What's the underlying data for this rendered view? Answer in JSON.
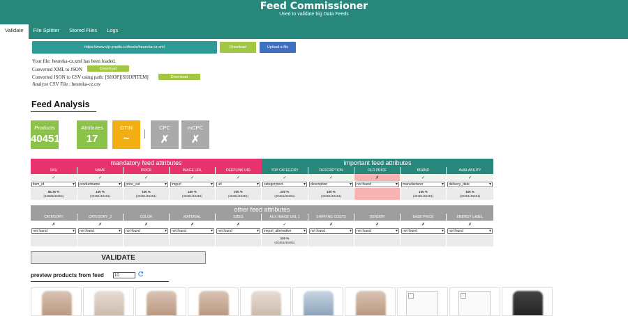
{
  "app": {
    "title": "Feed Commissioner",
    "subtitle": "Used to validate big Data Feeds"
  },
  "tabs": [
    {
      "label": "Validate",
      "active": true
    },
    {
      "label": "File Splitter",
      "active": false
    },
    {
      "label": "Stored Files",
      "active": false
    },
    {
      "label": "Logs",
      "active": false
    }
  ],
  "feed": {
    "url": "https://www.vip-pradlo.cz/feeds/heureka-cz.xml",
    "download_label": "Download",
    "upload_label": "Upload a file"
  },
  "log": {
    "loaded": "Your file: heureka-cz.xml has been loaded.",
    "converted_xml": "Converted XML to JSON",
    "converted_json": "Converted JSON to CSV using path: [SHOP][SHOPITEM]",
    "analyze": "Analyze CSV File : heureka-cz.csv",
    "download_label": "Download"
  },
  "analysis": {
    "title": "Feed Analysis",
    "stats": [
      {
        "label": "Products",
        "value": "40451",
        "color": "#8bc34a"
      },
      {
        "label": "Attributes",
        "value": "17",
        "color": "#8bc34a"
      },
      {
        "label": "GTIN",
        "value": "~",
        "color": "#f2ae13"
      },
      {
        "label": "CPC",
        "value": "✗",
        "color": "#aaaaaa"
      },
      {
        "label": "mCPC",
        "value": "✗",
        "color": "#aaaaaa"
      }
    ]
  },
  "mandatory": {
    "title": "mandatory feed attributes",
    "columns": [
      {
        "header": "SKU",
        "check": "✓",
        "field": "item_id",
        "pct": "85.75 %",
        "count": "(34686/40451)"
      },
      {
        "header": "NAME",
        "check": "✓",
        "field": "productname",
        "pct": "100 %",
        "count": "(40451/40451)"
      },
      {
        "header": "PRICE",
        "check": "✓",
        "field": "price_vat",
        "pct": "100 %",
        "count": "(40451/40451)"
      },
      {
        "header": "IMAGE URL",
        "check": "✓",
        "field": "imgurl",
        "pct": "100 %",
        "count": "(40451/40451)"
      },
      {
        "header": "DEEPLINK URL",
        "check": "✓",
        "field": "url",
        "pct": "100 %",
        "count": "(40451/40451)"
      }
    ]
  },
  "important": {
    "title": "important feed attributes",
    "columns": [
      {
        "header": "TOP CATEGORY",
        "check": "✓",
        "field": "categorytext",
        "pct": "100 %",
        "count": "(40451/40451)"
      },
      {
        "header": "DESCRIPTION",
        "check": "✓",
        "field": "description",
        "pct": "100 %",
        "count": "(40451/40451)"
      },
      {
        "header": "OLD PRICE",
        "check": "✗",
        "field": "not found",
        "pct": "",
        "count": ""
      },
      {
        "header": "BRAND",
        "check": "✓",
        "field": "manufacturer",
        "pct": "100 %",
        "count": "(40451/40451)"
      },
      {
        "header": "AVAILABILITY",
        "check": "✓",
        "field": "delivery_date",
        "pct": "100 %",
        "count": "(40451/40451)"
      }
    ]
  },
  "other": {
    "title": "other feed attributes",
    "columns": [
      {
        "header": "CATEGORY",
        "check": "✗",
        "field": "not found",
        "pct": "",
        "count": ""
      },
      {
        "header": "CATEGORY_2",
        "check": "✗",
        "field": "not found",
        "pct": "",
        "count": ""
      },
      {
        "header": "COLOR",
        "check": "✗",
        "field": "not found",
        "pct": "",
        "count": ""
      },
      {
        "header": "MATERIAL",
        "check": "✗",
        "field": "not found",
        "pct": "",
        "count": ""
      },
      {
        "header": "SIZES",
        "check": "✗",
        "field": "not found",
        "pct": "",
        "count": ""
      },
      {
        "header": "AUX IMAGE URL 1",
        "check": "✓",
        "field": "imgurl_alternative",
        "pct": "100 %",
        "count": "(40451/40451)"
      },
      {
        "header": "SHIPPING COSTS",
        "check": "✗",
        "field": "not found",
        "pct": "",
        "count": ""
      },
      {
        "header": "GENDER",
        "check": "✗",
        "field": "not found",
        "pct": "",
        "count": ""
      },
      {
        "header": "BASE PRICE",
        "check": "✗",
        "field": "not found",
        "pct": "",
        "count": ""
      },
      {
        "header": "ENERGY LABEL",
        "check": "✗",
        "field": "not found",
        "pct": "",
        "count": ""
      }
    ]
  },
  "validate_label": "VALIDATE",
  "preview": {
    "label": "preview products from feed",
    "count": "10"
  },
  "colors": {
    "brand": "#27877b",
    "mandatory": "#e8336f",
    "other": "#9e9e9e",
    "download": "#a2c744",
    "upload": "#3f6fbf"
  }
}
